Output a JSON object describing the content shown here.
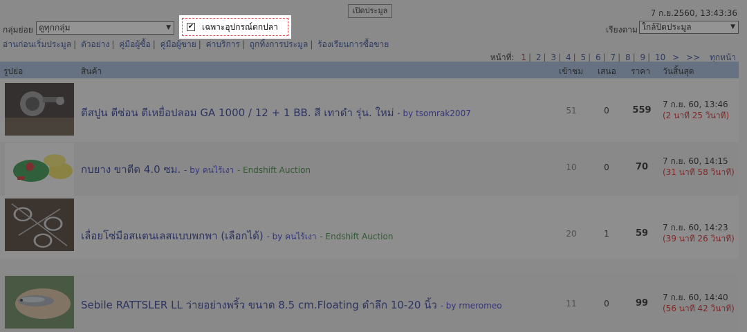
{
  "header": {
    "open_auction_button": "เปิดประมูล",
    "datetime": "7 ก.ย.2560, 13:43:36",
    "group_label": "กลุ่มย่อย",
    "group_select_value": "ดูทุกกลุ่ม",
    "filter_label": "เฉพาะอุปกรณ์ตกปลา",
    "sort_label": "เรียงตาม",
    "sort_select_value": "ใกล้ปิดประมูล"
  },
  "nav": [
    "อ่านก่อนเริ่มประมูล",
    "ตัวอย่าง",
    "คู่มือผู้ซื้อ",
    "คู่มือผู้ขาย",
    "ค่าบริการ",
    "ถูกทิ้งการประมูล",
    "ร้องเรียนการซื้อขาย"
  ],
  "pager": {
    "label": "หน้าที่:",
    "current": "1",
    "pages": [
      "2",
      "3",
      "4",
      "5",
      "6",
      "7",
      "8",
      "9",
      "10"
    ],
    "next": ">",
    "last": ">>",
    "all": "ทุกหน้า"
  },
  "columns": {
    "thumb": "รูปย่อ",
    "product": "สินค้า",
    "views": "เข้าชม",
    "bids": "เสนอ",
    "price": "ราคา",
    "end": "วันสิ้นสุด"
  },
  "rows": [
    {
      "title": "ตีสปูน ตีซ่อน ตีเหยื่อปลอม GA 1000 / 12 + 1 BB. สี เทาดำ รุ่น. ใหม่",
      "by": "- by tsomrak2007",
      "shop": "",
      "views": "51",
      "bids": "0",
      "price": "559",
      "end_date": "7 ก.ย. 60, 13:46",
      "time_left": "(2 นาที 25 วินาที)"
    },
    {
      "title": "กบยาง ขาตีด 4.0 ซม.",
      "by": "- by คนไร้เงา",
      "shop": "- Endshift Auction",
      "views": "10",
      "bids": "0",
      "price": "70",
      "end_date": "7 ก.ย. 60, 14:15",
      "time_left": "(31 นาที 58 วินาที)"
    },
    {
      "title": "เลื่อยโซ่มือสแตนเลสแบบพกพา (เลือกได้)",
      "by": "- by คนไร้เงา",
      "shop": "- Endshift Auction",
      "views": "20",
      "bids": "1",
      "price": "59",
      "end_date": "7 ก.ย. 60, 14:23",
      "time_left": "(39 นาที 26 วินาที)"
    },
    {
      "title": "Sebile RATTSLER LL ว่ายอย่างพริ้ว ขนาด 8.5 cm.Floating ดำลึก 10-20 นิ้ว",
      "by": "- by rmeromeo",
      "shop": "",
      "views": "11",
      "bids": "0",
      "price": "99",
      "end_date": "7 ก.ย. 60, 14:40",
      "time_left": "(56 นาที 42 วินาที)"
    }
  ]
}
